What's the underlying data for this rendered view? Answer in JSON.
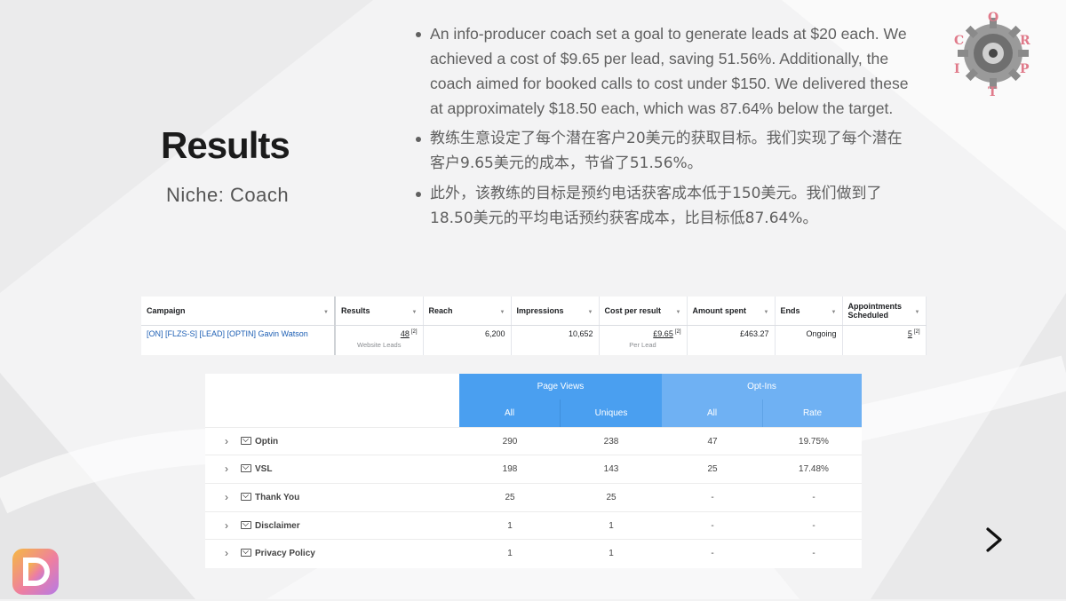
{
  "slide": {
    "title": "Results",
    "niche": "Niche: Coach",
    "bullets": [
      "An info-producer coach set a goal to generate leads at $20 each. We achieved a cost of $9.65 per lead, saving 51.56%. Additionally, the coach aimed for booked calls to cost under $150. We delivered these at approximately $18.50 each, which was 87.64% below the target.",
      "教练生意设定了每个潜在客户20美元的获取目标。我们实现了每个潜在客户9.65美元的成本，节省了51.56%。",
      "此外，该教练的目标是预约电话获客成本低于150美元。我们做到了18.50美元的平均电话预约获客成本，比目标低87.64%。"
    ]
  },
  "ads_table": {
    "headers": [
      "Campaign",
      "Results",
      "Reach",
      "Impressions",
      "Cost per result",
      "Amount spent",
      "Ends",
      "Appointments Scheduled"
    ],
    "row": {
      "campaign": "[ON] [FLZS-S] [LEAD] [OPTIN] Gavin Watson",
      "results": "48",
      "results_sup": "[2]",
      "results_sub": "Website Leads",
      "reach": "6,200",
      "impressions": "10,652",
      "cost_per_result": "£9.65",
      "cost_sup": "[2]",
      "cost_sub": "Per Lead",
      "amount_spent": "£463.27",
      "ends": "Ongoing",
      "appointments": "5",
      "appointments_sup": "[2]"
    }
  },
  "funnel_table": {
    "group_headers": [
      "Page Views",
      "Opt-Ins"
    ],
    "sub_headers": [
      "All",
      "Uniques",
      "All",
      "Rate"
    ],
    "rows": [
      {
        "name": "Optin",
        "views_all": "290",
        "views_uniques": "238",
        "optins_all": "47",
        "optins_rate": "19.75%"
      },
      {
        "name": "VSL",
        "views_all": "198",
        "views_uniques": "143",
        "optins_all": "25",
        "optins_rate": "17.48%"
      },
      {
        "name": "Thank You",
        "views_all": "25",
        "views_uniques": "25",
        "optins_all": "-",
        "optins_rate": "-"
      },
      {
        "name": "Disclaimer",
        "views_all": "1",
        "views_uniques": "1",
        "optins_all": "-",
        "optins_rate": "-"
      },
      {
        "name": "Privacy Policy",
        "views_all": "1",
        "views_uniques": "1",
        "optins_all": "-",
        "optins_rate": "-"
      }
    ]
  },
  "logo_letters": [
    "O",
    "R",
    "P",
    "T",
    "I",
    "C"
  ],
  "icons": {
    "next": "chevron-right-icon",
    "row_expand": "chevron-right-icon",
    "row_type": "mail-icon",
    "brand": "brand-logo-icon",
    "gear": "gear-logo-icon"
  },
  "colors": {
    "page_views_header": "#4a9ff0",
    "optins_header": "#6fb1f3",
    "campaign_link": "#1d5fb4"
  }
}
